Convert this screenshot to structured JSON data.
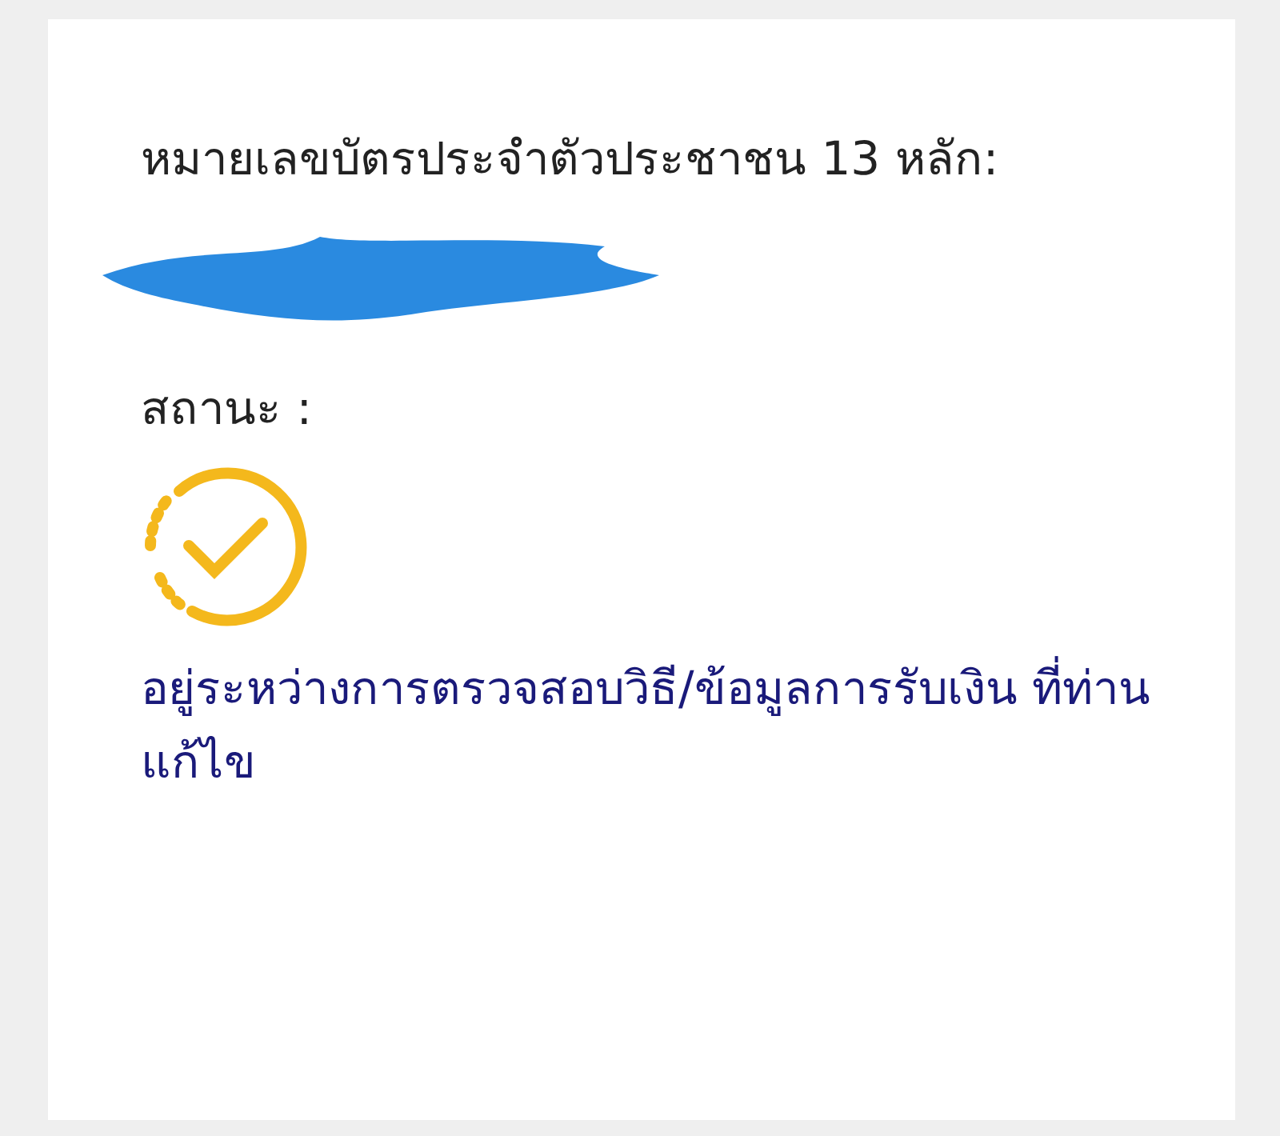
{
  "id_label": "หมายเลขบัตรประจำตัวประชาชน 13 หลัก:",
  "status_label": "สถานะ :",
  "status": {
    "kind": "pending",
    "text": "อยู่ระหว่างการตรวจสอบวิธี/ข้อมูลการรับเงิน ที่ท่านแก้ไข"
  }
}
